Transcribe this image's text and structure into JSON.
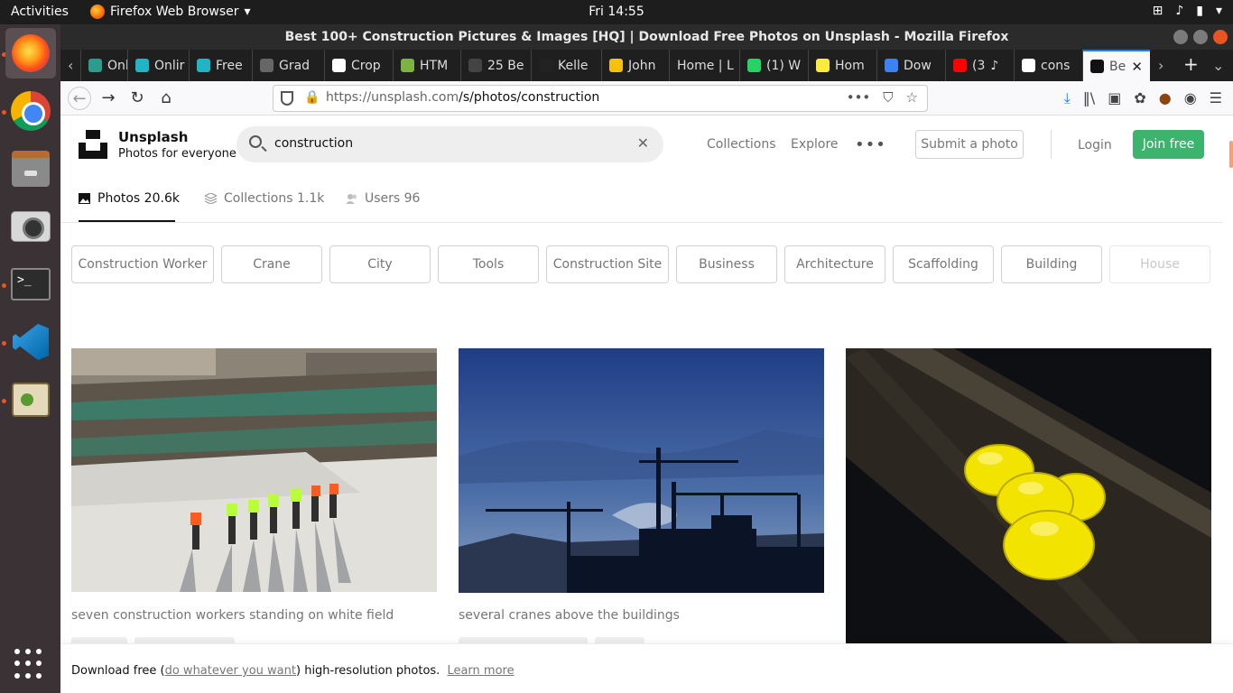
{
  "topbar": {
    "activities": "Activities",
    "app_name": "Firefox Web Browser",
    "app_menu_arrow": "▾",
    "clock": "Fri 14:55",
    "tray_icons": [
      "network-icon",
      "volume-icon",
      "battery-icon",
      "power-menu-icon"
    ],
    "tray_glyphs": [
      "⊞",
      "♪",
      "▮",
      "▾"
    ]
  },
  "dock": {
    "apps": [
      "firefox",
      "chrome",
      "files",
      "camera",
      "terminal",
      "vscode",
      "gimp"
    ],
    "terminal_glyph": ">_",
    "show_apps": "show-applications-icon"
  },
  "window": {
    "title": "Best 100+ Construction Pictures & Images [HQ] | Download Free Photos on Unsplash - Mozilla Firefox"
  },
  "tabs": [
    {
      "label": "Onlin",
      "color": "#2a9d8f"
    },
    {
      "label": "Onlir",
      "color": "#1fb5c4"
    },
    {
      "label": "Free",
      "color": "#1fb5c4"
    },
    {
      "label": "Grad",
      "color": "#666666"
    },
    {
      "label": "Crop",
      "color": "#ffffff"
    },
    {
      "label": "HTM",
      "color": "#7cb342"
    },
    {
      "label": "25 Be",
      "color": "#444444"
    },
    {
      "label": "Kelle",
      "color": "#222222"
    },
    {
      "label": "John",
      "color": "#f4c20d"
    },
    {
      "label": "Home | L",
      "color": "#1f1f1f"
    },
    {
      "label": "(1) W",
      "color": "#25d366"
    },
    {
      "label": "Hom",
      "color": "#ffeb3b"
    },
    {
      "label": "Dow",
      "color": "#3b82f6"
    },
    {
      "label": "(3",
      "color": "#ff0000"
    },
    {
      "label": "cons",
      "color": "#ffffff"
    },
    {
      "label": "Be",
      "color": "#111111"
    }
  ],
  "navbar": {
    "url_host": "https://unsplash.com",
    "url_path": "/s/photos/construction",
    "back_glyph": "←",
    "forward_glyph": "→",
    "reload_glyph": "↻",
    "home_glyph": "⌂",
    "lock_glyph": "🔒",
    "url_actions": [
      "•••",
      "⛉",
      "☆"
    ],
    "toolbar_glyphs": [
      "⤓",
      "‖\\",
      "▣",
      "✿",
      "●",
      "◉",
      "☰"
    ]
  },
  "header": {
    "brand_name": "Unsplash",
    "brand_tagline": "Photos for everyone",
    "search_value": "construction",
    "search_clear": "✕",
    "nav_collections": "Collections",
    "nav_explore": "Explore",
    "nav_more": "•••",
    "submit_label": "Submit a photo",
    "login_label": "Login",
    "join_label": "Join free",
    "join_color": "#3cb46e"
  },
  "result_tabs": [
    {
      "label": "Photos 20.6k",
      "active": true
    },
    {
      "label": "Collections 1.1k",
      "active": false
    },
    {
      "label": "Users 96",
      "active": false
    }
  ],
  "related_chips": [
    "Construction Worker",
    "Crane",
    "City",
    "Tools",
    "Construction Site",
    "Business",
    "Architecture",
    "Scaffolding",
    "Building",
    "House"
  ],
  "photos": [
    {
      "caption": "seven construction workers standing on white field"
    },
    {
      "caption": "several cranes above the buildings"
    },
    {
      "caption": ""
    }
  ],
  "cookie_banner": {
    "prefix": "Download free (",
    "link1": "do whatever you want",
    "middle": ") high-resolution photos.",
    "link2": "Learn more"
  }
}
